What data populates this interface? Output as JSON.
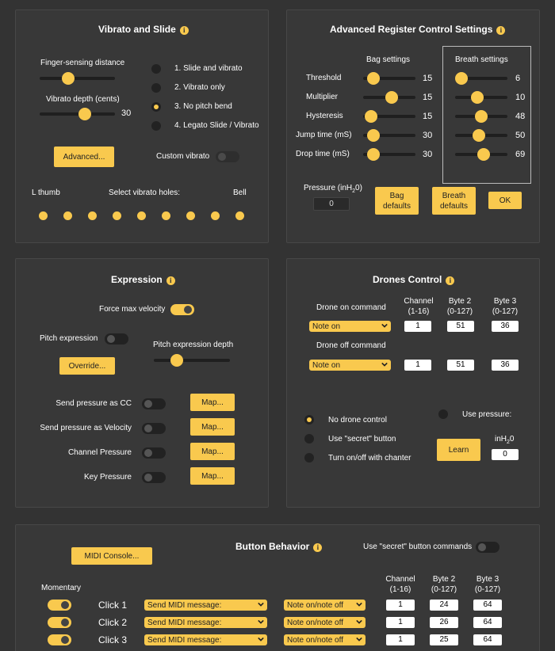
{
  "vibrato": {
    "title": "Vibrato and Slide",
    "finger_label": "Finger-sensing distance",
    "finger_value": 0.38,
    "depth_label": "Vibrato depth (cents)",
    "depth_value": "30",
    "depth_pos": 0.6,
    "modes": [
      "1. Slide and vibrato",
      "2. Vibrato only",
      "3. No pitch bend",
      "4. Legato Slide / Vibrato"
    ],
    "selected_mode": 2,
    "advanced_label": "Advanced...",
    "custom_label": "Custom vibrato",
    "lthumb_label": "L thumb",
    "select_holes_label": "Select vibrato holes:",
    "bell_label": "Bell"
  },
  "register": {
    "title": "Advanced Register Control Settings",
    "bag_header": "Bag settings",
    "breath_header": "Breath settings",
    "rows": [
      {
        "label": "Threshold",
        "bag": "15",
        "bag_pos": 0.2,
        "breath": "6",
        "breath_pos": 0.12
      },
      {
        "label": "Multiplier",
        "bag": "15",
        "bag_pos": 0.55,
        "breath": "10",
        "breath_pos": 0.42
      },
      {
        "label": "Hysteresis",
        "bag": "15",
        "bag_pos": 0.15,
        "breath": "48",
        "breath_pos": 0.5
      },
      {
        "label": "Jump time (mS)",
        "bag": "30",
        "bag_pos": 0.2,
        "breath": "50",
        "breath_pos": 0.45
      },
      {
        "label": "Drop time (mS)",
        "bag": "30",
        "bag_pos": 0.2,
        "breath": "69",
        "breath_pos": 0.55
      }
    ],
    "pressure_label": "Pressure (inH",
    "pressure_sub": "2",
    "pressure_close": "0)",
    "pressure_value": "0",
    "bag_defaults": "Bag defaults",
    "breath_defaults": "Breath defaults",
    "ok": "OK"
  },
  "expression": {
    "title": "Expression",
    "force_label": "Force max velocity",
    "pitch_label": "Pitch expression",
    "pitch_depth_label": "Pitch expression depth",
    "pitch_depth_pos": 0.3,
    "override_label": "Override...",
    "rows": [
      {
        "label": "Send pressure as CC",
        "map": "Map..."
      },
      {
        "label": "Send pressure as Velocity",
        "map": "Map..."
      },
      {
        "label": "Channel Pressure",
        "map": "Map..."
      },
      {
        "label": "Key Pressure",
        "map": "Map..."
      }
    ]
  },
  "drones": {
    "title": "Drones Control",
    "channel_header": [
      "Channel",
      "(1-16)"
    ],
    "byte2_header": [
      "Byte 2",
      "(0-127)"
    ],
    "byte3_header": [
      "Byte 3",
      "(0-127)"
    ],
    "on_label": "Drone on command",
    "off_label": "Drone off command",
    "on_select": "Note on",
    "off_select": "Note on",
    "on_values": [
      "1",
      "51",
      "36"
    ],
    "off_values": [
      "1",
      "51",
      "36"
    ],
    "options": [
      "No drone control",
      "Use \"secret\" button",
      "Turn on/off with chanter"
    ],
    "use_pressure_label": "Use pressure:",
    "learn_label": "Learn",
    "inh2o_label": "inH",
    "inh2o_sub": "2",
    "inh2o_close": "0",
    "pressure_value": "0"
  },
  "buttons": {
    "title": "Button Behavior",
    "midi_console": "MIDI Console...",
    "secret_label": "Use \"secret\" button commands",
    "momentary_label": "Momentary",
    "channel_header": [
      "Channel",
      "(1-16)"
    ],
    "byte2_header": [
      "Byte 2",
      "(0-127)"
    ],
    "byte3_header": [
      "Byte 3",
      "(0-127)"
    ],
    "rows": [
      {
        "label": "Click 1",
        "action": "Send MIDI message:",
        "type": "Note on/note off",
        "channel": "1",
        "byte2": "24",
        "byte3": "64"
      },
      {
        "label": "Click 2",
        "action": "Send MIDI message:",
        "type": "Note on/note off",
        "channel": "1",
        "byte2": "26",
        "byte3": "64"
      },
      {
        "label": "Click 3",
        "action": "Send MIDI message:",
        "type": "Note on/note off",
        "channel": "1",
        "byte2": "25",
        "byte3": "64"
      }
    ]
  },
  "colors": {
    "accent": "#f9c94e",
    "panel": "#383838",
    "background": "#333333"
  }
}
